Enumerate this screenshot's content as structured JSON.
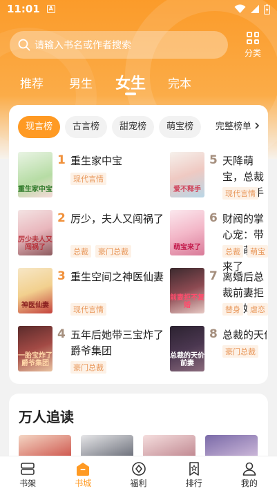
{
  "status_bar": {
    "time": "11:01",
    "badge": "A"
  },
  "search": {
    "placeholder": "请输入书名或作者搜索"
  },
  "classify": {
    "label": "分类",
    "icon": "grid-icon"
  },
  "tabs": [
    {
      "label": "推荐"
    },
    {
      "label": "男生"
    },
    {
      "label": "女生",
      "active": true
    },
    {
      "label": "完本"
    }
  ],
  "chips": [
    {
      "label": "现言榜",
      "active": true
    },
    {
      "label": "古言榜"
    },
    {
      "label": "甜宠榜"
    },
    {
      "label": "萌宝榜"
    }
  ],
  "full_list": {
    "label": "完整榜单"
  },
  "books": [
    {
      "rank": "1",
      "title": "重生家中宝",
      "tags": [
        "现代言情"
      ],
      "cover_text": "重生家中宝"
    },
    {
      "rank": "2",
      "title": "厉少，夫人又闯祸了",
      "tags": [
        "总裁",
        "豪门总裁"
      ],
      "cover_text": "厉少夫人又闯祸了"
    },
    {
      "rank": "3",
      "title": "重生空间之神医仙妻",
      "tags": [
        "现代言情"
      ],
      "cover_text": "神医仙妻"
    },
    {
      "rank": "4",
      "title": "五年后她带三宝炸了爵爷集团",
      "tags": [
        "豪门总裁"
      ],
      "cover_text": "一胎宝炸了爵爷集团"
    },
    {
      "rank": "5",
      "title": "天降萌宝，总裁爱不释手",
      "tags": [
        "现代言情"
      ],
      "cover_text": "爱不释手"
    },
    {
      "rank": "6",
      "title": "财阀的掌心宠：带三个萌宝来了",
      "tags": [
        "总裁",
        "萌宝"
      ],
      "cover_text": "萌宝来了"
    },
    {
      "rank": "7",
      "title": "离婚后总裁前妻拒不复婚",
      "tags": [
        "替身",
        "虐恋"
      ],
      "cover_text": "前妻拒不复婚"
    },
    {
      "rank": "8",
      "title": "总裁的天价前妻",
      "tags": [
        "豪门总裁"
      ],
      "cover_text": "总裁的天价前妻"
    }
  ],
  "section2": {
    "title": "万人追读"
  },
  "nav": [
    {
      "label": "书架",
      "icon": "bookshelf-icon"
    },
    {
      "label": "书城",
      "icon": "bookstore-icon",
      "active": true
    },
    {
      "label": "福利",
      "icon": "welfare-icon"
    },
    {
      "label": "排行",
      "icon": "ranking-icon"
    },
    {
      "label": "我的",
      "icon": "profile-icon"
    }
  ],
  "colors": {
    "accent": "#ff9a23",
    "tag_text": "#e8975a",
    "tag_bg": "#fdf1e6"
  }
}
